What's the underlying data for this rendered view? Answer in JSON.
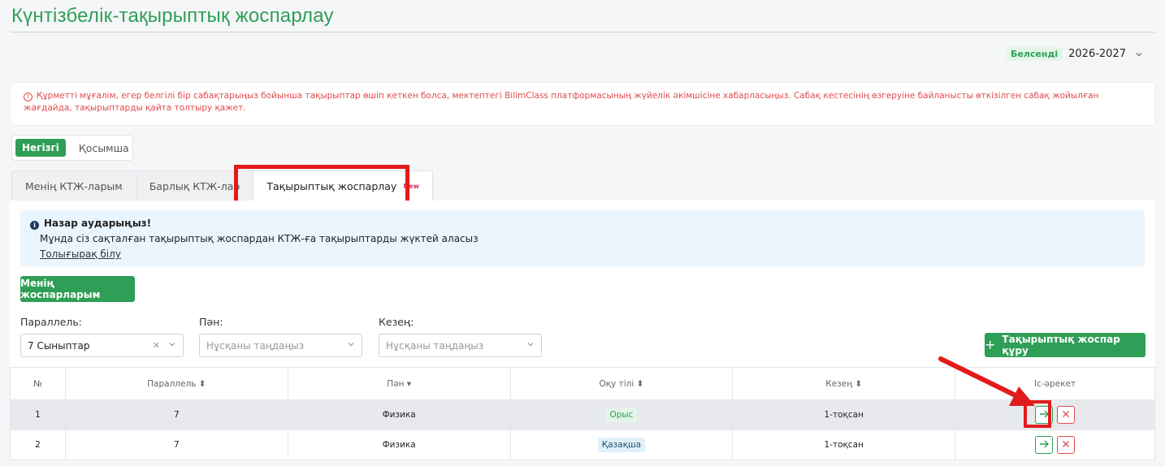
{
  "page": {
    "title": "Күнтізбелік-тақырыптық жоспарлау"
  },
  "year": {
    "status": "Белсенді",
    "value": "2026-2027"
  },
  "warning": {
    "text": "Құрметті мұғалім, егер белгілі бір сабақтарыңыз бойынша тақырыптар өшіп кеткен болса, мектептегі BilimClass платформасының жүйелік әкімшісіне хабарласыңыз. Сабақ кестесінің өзгеруіне байланысты өткізілген сабақ жойылған жағдайда, тақырыптарды қайта толтыру қажет."
  },
  "segments": {
    "main": "Негізгі",
    "extra": "Қосымша"
  },
  "tabs": [
    {
      "label": "Менің КТЖ-ларым"
    },
    {
      "label": "Барлық КТЖ-лар"
    },
    {
      "label": "Тақырыптық жоспарлау",
      "badge": "New"
    }
  ],
  "notice": {
    "title": "Назар аударыңыз!",
    "body": "Мұнда сіз сақталған тақырыптық жоспардан КТЖ-ға тақырыптарды жүктей аласыз",
    "link": "Толығырақ білу"
  },
  "buttons": {
    "my_plans": "Менің жоспарларым",
    "create_plan": "Тақырыптық жоспар құру"
  },
  "filters": {
    "parallel": {
      "label": "Параллель:",
      "value": "7 Сыныптар"
    },
    "subject": {
      "label": "Пән:",
      "placeholder": "Нұсқаны таңдаңыз"
    },
    "period": {
      "label": "Кезең:",
      "placeholder": "Нұсқаны таңдаңыз"
    }
  },
  "table": {
    "headers": [
      "№",
      "Параллель ⬍",
      "Пән ▾",
      "Оқу тілі ⬍",
      "Кезең ⬍",
      "Іс-әрекет"
    ],
    "rows": [
      {
        "num": "1",
        "parallel": "7",
        "subject": "Физика",
        "lang": "Орыс",
        "period": "1-тоқсан"
      },
      {
        "num": "2",
        "parallel": "7",
        "subject": "Физика",
        "lang": "Қазақша",
        "period": "1-тоқсан"
      }
    ]
  },
  "colors": {
    "accent": "#2f9e57",
    "danger": "#e24b4b",
    "highlight": "#e11c1c"
  },
  "icons": [
    "chevron-down-icon",
    "warning-circle-icon",
    "info-icon",
    "clear-icon",
    "plus-icon",
    "arrow-right-icon",
    "close-icon"
  ]
}
